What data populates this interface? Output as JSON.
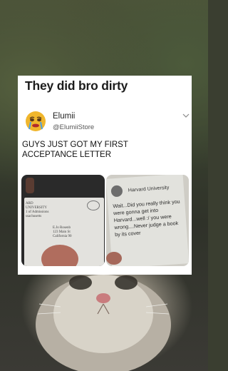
{
  "post": {
    "headline": "They did bro dirty"
  },
  "tweet": {
    "name": "Elumii",
    "handle": "@ElumiiStore",
    "text": "GUYS JUST GOT MY FIRST ACCEPTANCE LETTER"
  },
  "photos": {
    "envelope_lines": [
      "ARD UNIVERSITY",
      "1 of Admissions",
      "ssachusetts"
    ],
    "envelope_address": [
      "E.Jo Rosenb",
      "123 Main St",
      "California 90"
    ],
    "letter_title": "Harvard University",
    "letter_body": "Wait...Did you really think you were gonna get into Harvard...well :/ you were wrong....Never judge a book by its cover"
  },
  "colors": {
    "card_background": "#ffffff",
    "headline_text": "#1c1c1c"
  }
}
